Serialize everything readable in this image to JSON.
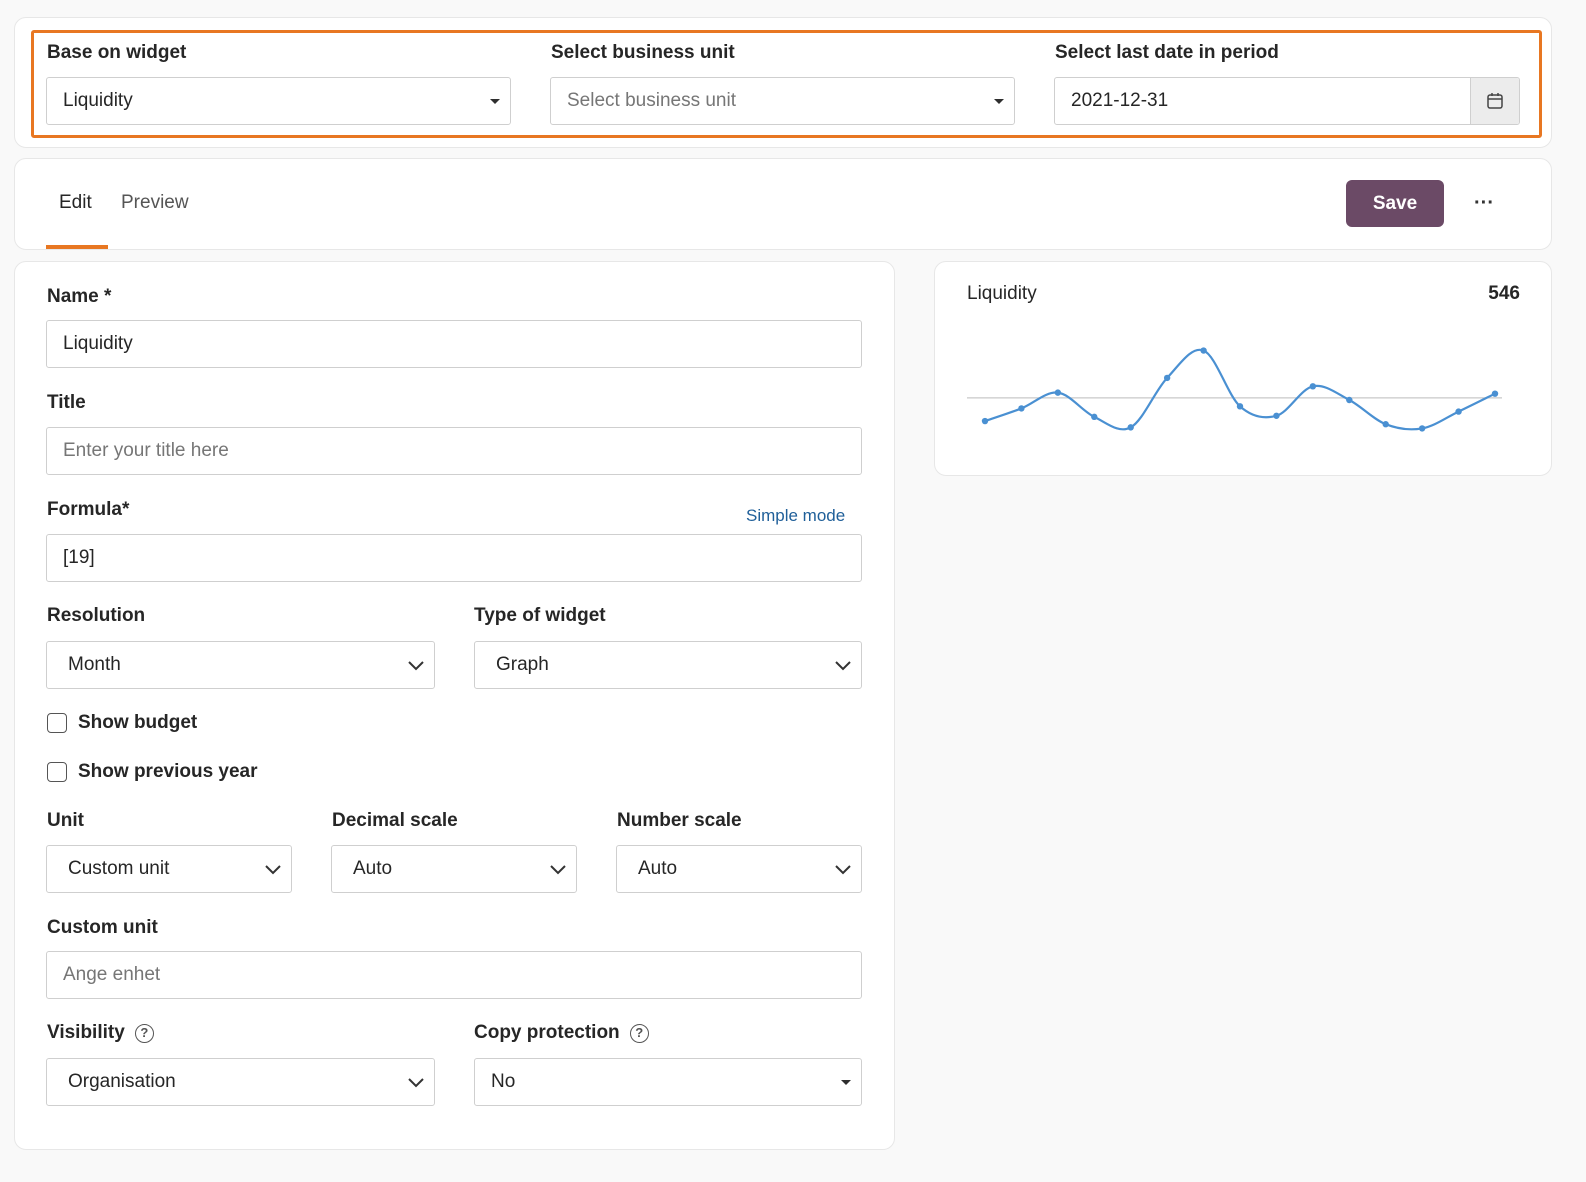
{
  "filters": {
    "base_widget_label": "Base on widget",
    "base_widget_value": "Liquidity",
    "business_unit_label": "Select business unit",
    "business_unit_placeholder": "Select business unit",
    "last_date_label": "Select last date in period",
    "last_date_value": "2021-12-31",
    "highlight_color": "#e87722"
  },
  "tabs": {
    "edit": "Edit",
    "preview": "Preview",
    "active": "Edit",
    "accent": "#e87722"
  },
  "toolbar": {
    "save_label": "Save",
    "save_color": "#6b4a66",
    "more_label": "···"
  },
  "form": {
    "name_label": "Name *",
    "name_value": "Liquidity",
    "title_label": "Title",
    "title_placeholder": "Enter your title here",
    "formula_label": "Formula*",
    "simple_mode_link": "Simple mode",
    "formula_value": "[19]",
    "resolution_label": "Resolution",
    "resolution_value": "Month",
    "widget_type_label": "Type of widget",
    "widget_type_value": "Graph",
    "show_budget_label": "Show budget",
    "show_budget_checked": false,
    "show_prev_year_label": "Show previous year",
    "show_prev_year_checked": false,
    "unit_label": "Unit",
    "unit_value": "Custom unit",
    "decimal_scale_label": "Decimal scale",
    "decimal_scale_value": "Auto",
    "number_scale_label": "Number scale",
    "number_scale_value": "Auto",
    "custom_unit_label": "Custom unit",
    "custom_unit_placeholder": "Ange enhet",
    "visibility_label": "Visibility",
    "visibility_value": "Organisation",
    "copy_protection_label": "Copy protection",
    "copy_protection_value": "No",
    "help_glyph": "?"
  },
  "preview": {
    "title": "Liquidity",
    "value": "546"
  },
  "chart_data": {
    "type": "line",
    "title": "Liquidity",
    "x": [
      1,
      2,
      3,
      4,
      5,
      6,
      7,
      8,
      9,
      10,
      11,
      12,
      13,
      14,
      15
    ],
    "values": [
      -22,
      -10,
      5,
      -18,
      -28,
      19,
      45,
      -8,
      -17,
      11,
      -2,
      -25,
      -29,
      -13,
      4
    ],
    "baseline": 0,
    "ylim": [
      -40,
      55
    ],
    "line_color": "#4a90d2",
    "baseline_color": "#c8c8c8",
    "grid": false,
    "xlabel": "",
    "ylabel": ""
  }
}
